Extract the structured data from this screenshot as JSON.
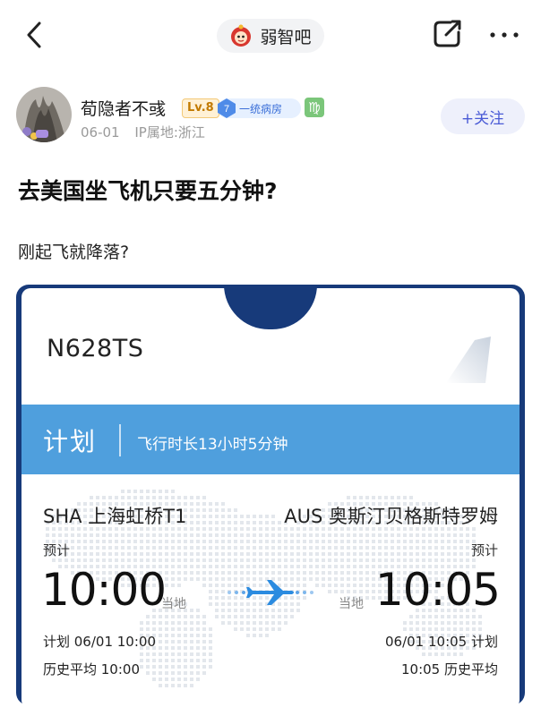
{
  "header": {
    "forum_name": "弱智吧",
    "icons": {
      "back": "chevron-left-icon",
      "share": "share-icon",
      "more": "more-icon"
    }
  },
  "author": {
    "name": "荀隐者不彧",
    "level": "Lv.8",
    "fan_level": "7",
    "fan_title": "一统病房",
    "zodiac": "♍",
    "date": "06-01",
    "ip_location": "IP属地:浙江",
    "follow_label": "+关注"
  },
  "post": {
    "title": "去美国坐飞机只要五分钟?",
    "body": "刚起飞就降落?"
  },
  "flight": {
    "number": "N628TS",
    "status": "计划",
    "duration": "飞行时长13小时5分钟",
    "departure": {
      "airport": "SHA 上海虹桥T1",
      "est_label": "预计",
      "time": "10:00",
      "local_label": "当地",
      "scheduled": "计划 06/01 10:00",
      "history_avg": "历史平均 10:00"
    },
    "arrival": {
      "airport": "AUS 奥斯汀贝格斯特罗姆",
      "est_label": "预计",
      "time": "10:05",
      "local_label": "当地",
      "scheduled": "06/01 10:05 计划",
      "history_avg": "10:05 历史平均"
    }
  },
  "colors": {
    "card_frame": "#173a7a",
    "plan_band": "#4f9fdd",
    "plane": "#2b8be0",
    "follow_text": "#4a5bd6"
  }
}
